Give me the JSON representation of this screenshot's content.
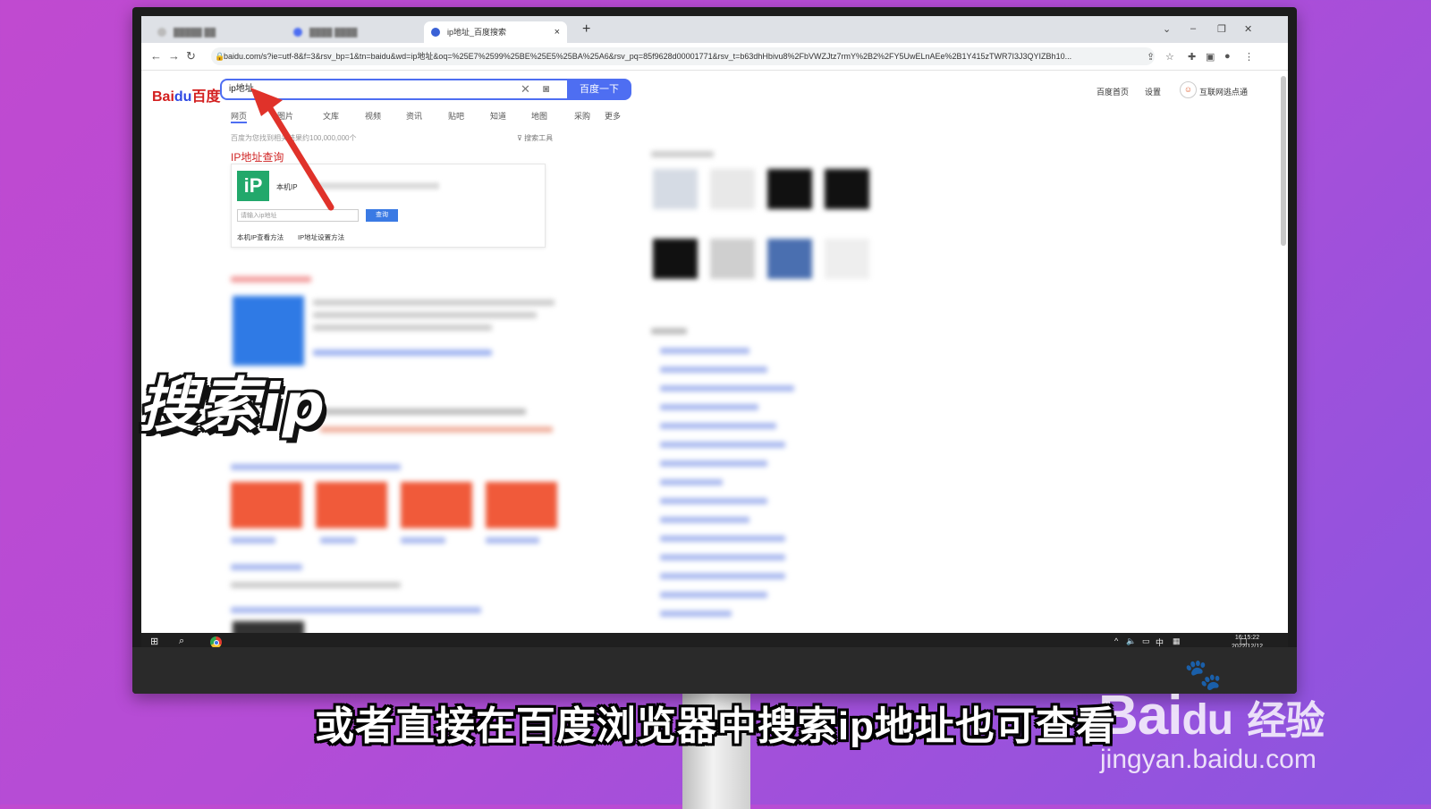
{
  "browser": {
    "tabs": [
      {
        "label": "",
        "active": false
      },
      {
        "label": "",
        "active": false
      },
      {
        "label": "ip地址_百度搜索",
        "active": true
      }
    ],
    "new_tab": "+",
    "close_tab": "×",
    "window_controls": [
      "⌄",
      "–",
      "❐",
      "✕"
    ],
    "url": "baidu.com/s?ie=utf-8&f=3&rsv_bp=1&tn=baidu&wd=ip地址&oq=%25E7%2599%25BE%25E5%25BA%25A6&rsv_pq=85f9628d00001771&rsv_t=b63dhHbivu8%2FbVWZJtz7rmY%2B2%2FY5UwELnAEe%2B1Y415zTWR7I3J3QYIZBh10..."
  },
  "baidu": {
    "logo_text": "Bai",
    "logo_paw": "du",
    "logo_cn": "百度",
    "search_value": "ip地址",
    "search_button": "百度一下",
    "top_links": [
      "百度首页",
      "设置",
      "互联网逃点通"
    ],
    "nav_tabs": [
      "网页",
      "图片",
      "文库",
      "视频",
      "资讯",
      "贴吧",
      "知道",
      "地图",
      "采购",
      "更多"
    ],
    "result_count": "百度为您找到相关结果约100,000,000个",
    "search_tools": "搜索工具",
    "ip_title": "IP地址查询",
    "ip_card": {
      "logo": "iP",
      "label": "本机IP",
      "input_placeholder": "请输入ip地址",
      "query_button": "查询",
      "links": [
        "本机IP查看方法",
        "IP地址设置方法"
      ]
    }
  },
  "taskbar": {
    "start_icon": "windows-icon",
    "search_icon": "search-icon",
    "ime": "中",
    "time": "16:15:22",
    "date": "2022/12/12"
  },
  "overlay": {
    "sticker_text": "搜索ip",
    "subtitle": "或者直接在百度浏览器中搜索ip地址也可查看",
    "watermark_brand": "Bai",
    "watermark_brand2": "经验",
    "watermark_url": "jingyan.baidu.com"
  },
  "colors": {
    "background": "#b44cd6",
    "baidu_blue": "#4e6ef2",
    "arrow_red": "#e0322a",
    "ip_green": "#22a86b"
  }
}
